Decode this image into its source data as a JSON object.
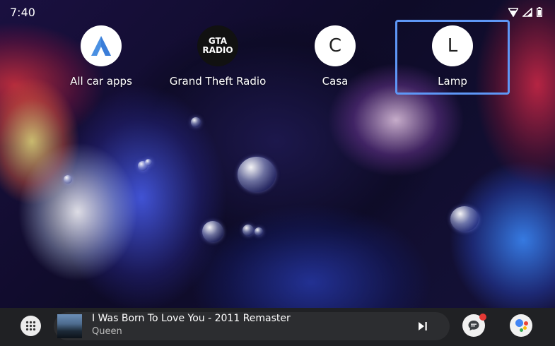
{
  "status_bar": {
    "time": "7:40",
    "icons": [
      "wifi-icon",
      "signal-icon",
      "battery-icon"
    ]
  },
  "apps": [
    {
      "label": "All car apps",
      "icon": "android-auto-icon"
    },
    {
      "label": "Grand Theft Radio",
      "icon": "gta-radio-logo",
      "logo_text": [
        "GTA",
        "RADIO"
      ]
    },
    {
      "label": "Casa",
      "icon_letter": "C"
    },
    {
      "label": "Lamp",
      "icon_letter": "L",
      "selected": true
    }
  ],
  "media": {
    "title": "I Was Born To Love You - 2011 Remaster",
    "artist": "Queen"
  },
  "colors": {
    "focus_border": "#5e97f6",
    "bottom_bar": "#202124",
    "notification_dot": "#e53935"
  }
}
